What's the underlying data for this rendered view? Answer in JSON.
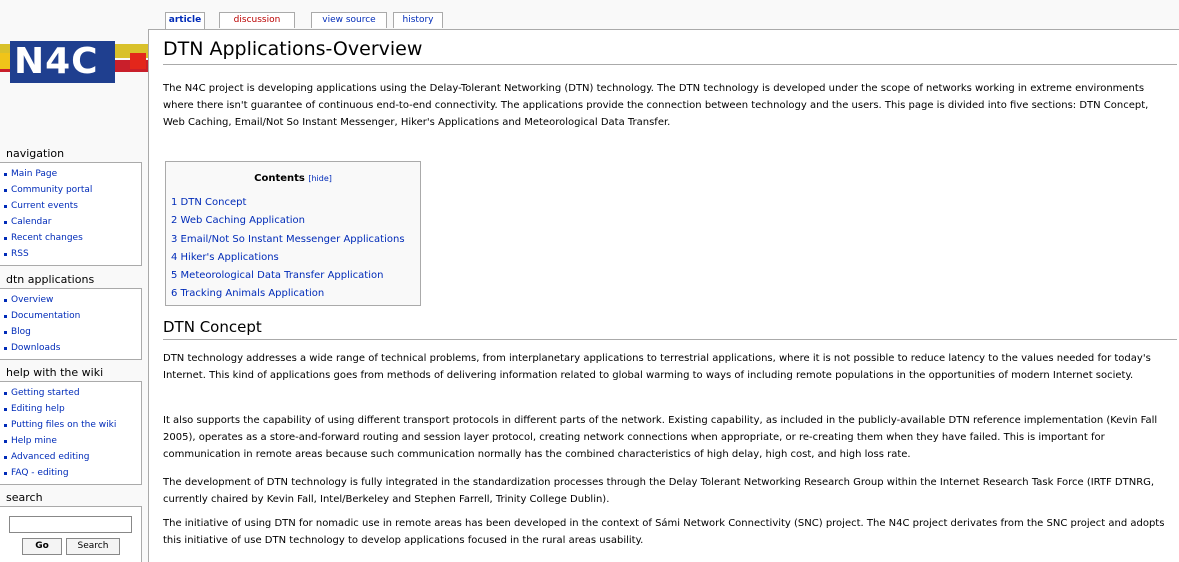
{
  "tabs": [
    {
      "label": "article"
    },
    {
      "label": "discussion"
    },
    {
      "label": "view source"
    },
    {
      "label": "history"
    }
  ],
  "logo": {
    "text": "N4C"
  },
  "sidebar": {
    "navigation": {
      "title": "navigation",
      "items": [
        "Main Page",
        "Community portal",
        "Current events",
        "Calendar",
        "Recent changes",
        "RSS"
      ]
    },
    "dtn": {
      "title": "dtn applications",
      "items": [
        "Overview",
        "Documentation",
        "Blog",
        "Downloads"
      ]
    },
    "help": {
      "title": "help with the wiki",
      "items": [
        "Getting started",
        "Editing help",
        "Putting files on the wiki",
        "Help mine",
        "Advanced editing",
        "FAQ - editing"
      ]
    },
    "search": {
      "title": "search",
      "go_label": "Go",
      "search_label": "Search",
      "value": ""
    }
  },
  "page": {
    "title": "DTN Applications-Overview",
    "intro": "The N4C project is developing applications using the Delay-Tolerant Networking (DTN) technology. The DTN technology is developed under the scope of networks working in extreme environments where there isn't guarantee of continuous end-to-end connectivity. The applications provide the connection between technology and the users. This page is divided into five sections: DTN Concept, Web Caching, Email/Not So Instant Messenger, Hiker's Applications and Meteorological Data Transfer.",
    "toc": {
      "title": "Contents",
      "hide_label": "[hide]",
      "items": [
        "1 DTN Concept",
        "2 Web Caching Application",
        "3 Email/Not So Instant Messenger Applications",
        "4 Hiker's Applications",
        "5 Meteorological Data Transfer Application",
        "6 Tracking Animals Application"
      ]
    },
    "section_heading": "DTN Concept",
    "paragraphs": [
      "DTN technology addresses a wide range of technical problems, from interplanetary applications to terrestrial applications, where it is not possible to reduce latency to the values needed for today's Internet. This kind of applications goes from methods of delivering information related to global warming to ways of including remote populations in the opportunities of modern Internet society.",
      "It also supports the capability of using different transport protocols in different parts of the network. Existing capability, as included in the publicly-available DTN reference implementation (Kevin Fall 2005), operates as a store-and-forward routing and session layer protocol, creating network connections when appropriate, or re-creating them when they have failed. This is important for communication in remote areas because such communication normally has the combined characteristics of high delay, high cost, and high loss rate.",
      "The development of DTN technology is fully integrated in the standardization processes through the Delay Tolerant Networking Research Group within the Internet Research Task Force (IRTF DTNRG, currently chaired by Kevin Fall, Intel/Berkeley and Stephen Farrell, Trinity College Dublin).",
      "The initiative of using DTN for nomadic use in remote areas has been developed in the context of Sámi Network Connectivity (SNC) project. The N4C project derivates from the SNC project and adopts this initiative of use DTN technology to develop applications focused in the rural areas usability."
    ]
  }
}
